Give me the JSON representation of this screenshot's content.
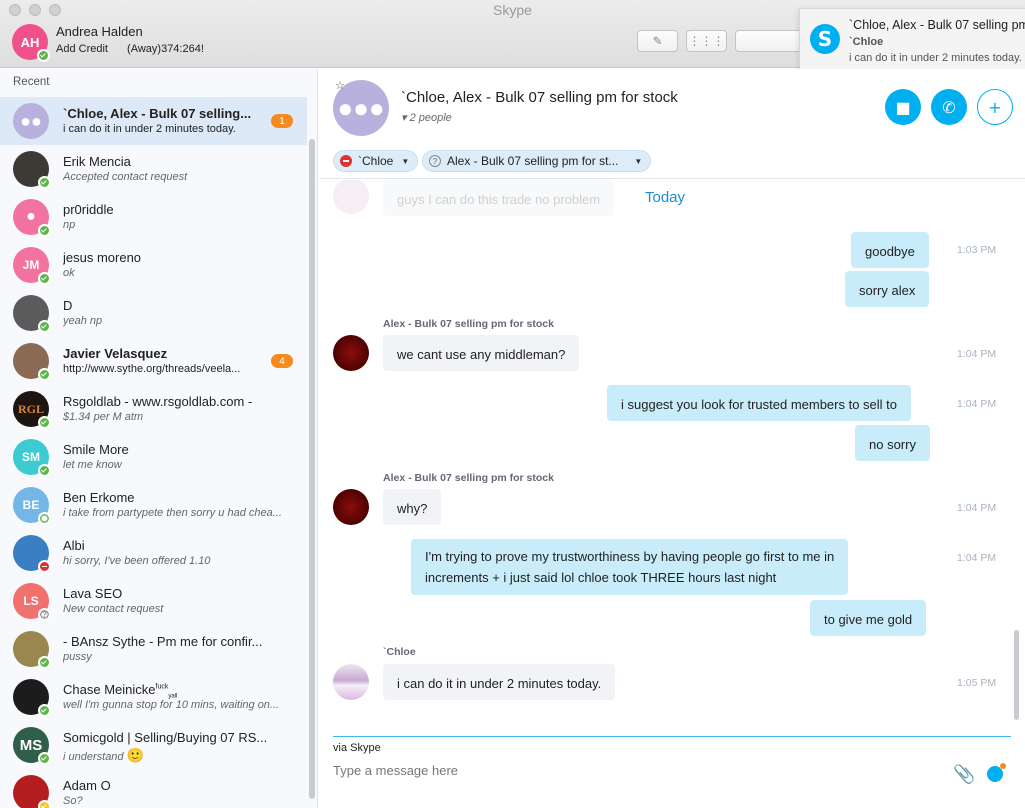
{
  "window": {
    "title": "Skype"
  },
  "me": {
    "initials": "AH",
    "name": "Andrea Halden",
    "credit": "Add Credit",
    "mood": "(Away)374:264!",
    "avatar_color": "#f0508c"
  },
  "notification": {
    "title": "`Chloe, Alex - Bulk 07 selling pm",
    "sender": "`Chloe",
    "message": "i can do it in under 2 minutes today."
  },
  "sidebar": {
    "recent_label": "Recent",
    "contacts": [
      {
        "name": "`Chloe, Alex - Bulk 07 selling...",
        "msg": "i can do it in under 2 minutes today.",
        "badge": "1"
      },
      {
        "name": "Erik Mencia",
        "msg": "Accepted contact request"
      },
      {
        "name": "pr0riddle",
        "msg": "np"
      },
      {
        "name": "jesus moreno",
        "msg": "ok",
        "initials": "JM"
      },
      {
        "name": "D",
        "msg": "yeah np"
      },
      {
        "name": "Javier Velasquez",
        "msg": "http://www.sythe.org/threads/veela...",
        "badge": "4"
      },
      {
        "name": "Rsgoldlab - www.rsgoldlab.com -",
        "msg": "$1.34 per M atm",
        "initials": "RGL"
      },
      {
        "name": "Smile More",
        "msg": "let me know",
        "initials": "SM"
      },
      {
        "name": "Ben Erkome",
        "msg": "i take from partypete then sorry u had chea...",
        "initials": "BE"
      },
      {
        "name": "Albi",
        "msg": "hi sorry, I've been offered 1.10"
      },
      {
        "name": "Lava SEO",
        "msg": "New contact request",
        "initials": "LS"
      },
      {
        "name": "- BAnsz Sythe - Pm me for confir...",
        "msg": "pussy"
      },
      {
        "name": "Chase Meinicke",
        "name_sup": "fuck",
        "name_sub": "yall",
        "msg": "well I'm gunna stop for 10 mins, waiting on..."
      },
      {
        "name": "Somicgold  | Selling/Buying 07 RS...",
        "msg": "i understand",
        "initials": "MS"
      },
      {
        "name": "Adam O",
        "msg": "So?"
      }
    ]
  },
  "chat": {
    "title": "`Chloe, Alex - Bulk 07 selling pm for stock",
    "people": "2 people",
    "participants": [
      "`Chloe",
      "Alex - Bulk 07 selling pm for st..."
    ],
    "today_label": "Today",
    "faded_message": "guys I can do this trade no problem",
    "messages": [
      {
        "text": "goodbye",
        "time": "1:03 PM"
      },
      {
        "text": "sorry alex"
      },
      {
        "sender": "Alex - Bulk 07 selling pm for stock",
        "text": "we cant use any middleman?",
        "time": "1:04 PM"
      },
      {
        "text": "i suggest you look for trusted members to sell to",
        "time": "1:04 PM"
      },
      {
        "text": "no sorry"
      },
      {
        "sender": "Alex - Bulk 07 selling pm for stock",
        "text": "why?",
        "time": "1:04 PM"
      },
      {
        "text_line1": "I'm trying to prove my trustworthiness by having people go first to me in",
        "text_line2": "increments + i just said lol chloe took THREE hours last night",
        "time": "1:04 PM"
      },
      {
        "text": "to give me gold"
      },
      {
        "sender": "`Chloe",
        "text": "i can do it in under 2 minutes today.",
        "time": "1:05 PM"
      }
    ]
  },
  "composer": {
    "via": "via Skype",
    "placeholder": "Type a message here"
  },
  "colors": {
    "accent": "#00aff0",
    "badge": "#f78a1d",
    "online": "#5cb64b",
    "busy": "#e0312f"
  }
}
